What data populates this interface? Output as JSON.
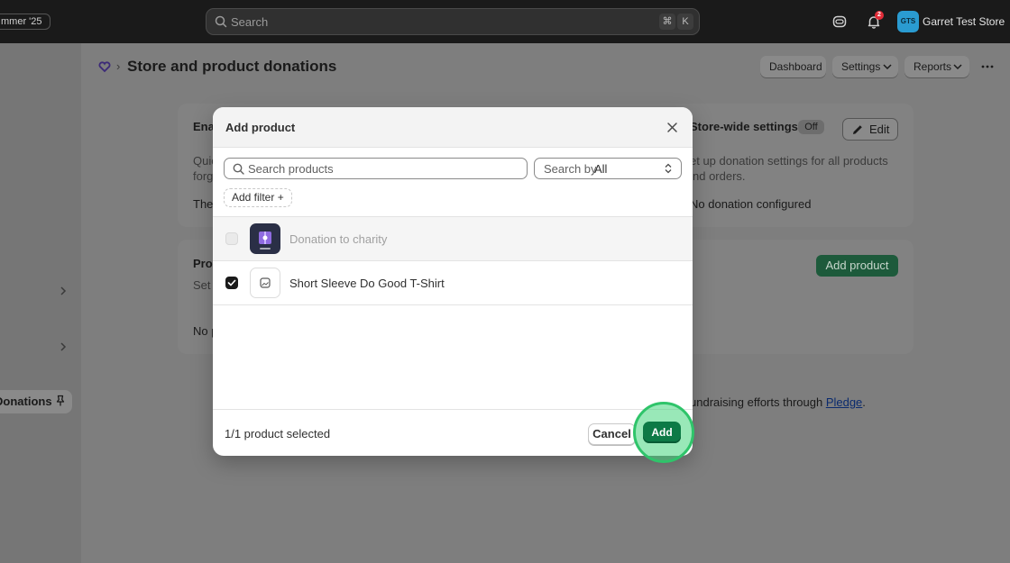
{
  "topbar": {
    "edition_label": "mmer '25",
    "search_placeholder": "Search",
    "shortcut_keys": [
      "⌘",
      "K"
    ],
    "notification_count": "2",
    "store_avatar_initials": "GTS",
    "store_name": "Garret Test Store"
  },
  "sidebar": {
    "pinned_app": "Donations"
  },
  "page": {
    "title": "Store and product donations",
    "breadcrumb_separator": "›",
    "actions": [
      "Dashboard",
      "Settings",
      "Reports"
    ]
  },
  "cards": {
    "enable_title_partial": "Ena",
    "enable_desc_line1_partial": "Quic",
    "enable_desc_line2_partial": "forg",
    "enable_footer_partial": "The",
    "storewide_title": "Store-wide settings",
    "storewide_status": "Off",
    "edit_label": "Edit",
    "storewide_desc_line1": "et up donation settings for all products",
    "storewide_desc_line2": "nd orders.",
    "storewide_empty": "No donation configured",
    "products_title_partial": "Pro",
    "products_desc_partial": "Set",
    "products_empty_partial": "No p",
    "add_product_label": "Add product",
    "footnote_text": "undraising efforts through ",
    "footnote_link": "Pledge",
    "footnote_end": "."
  },
  "modal": {
    "title": "Add product",
    "search_placeholder": "Search products",
    "search_by_label": "Search by",
    "search_by_value": "All",
    "add_filter_label": "Add filter +",
    "products": [
      {
        "name": "Donation to charity",
        "checked": false,
        "disabled": true
      },
      {
        "name": "Short Sleeve Do Good T-Shirt",
        "checked": true,
        "disabled": false
      }
    ],
    "selected_count": "1/1 product selected",
    "cancel_label": "Cancel",
    "add_label": "Add"
  },
  "colors": {
    "primary_green": "#0d7a46",
    "highlight_green": "#2fc46a",
    "topbar": "#1a1a1a"
  }
}
